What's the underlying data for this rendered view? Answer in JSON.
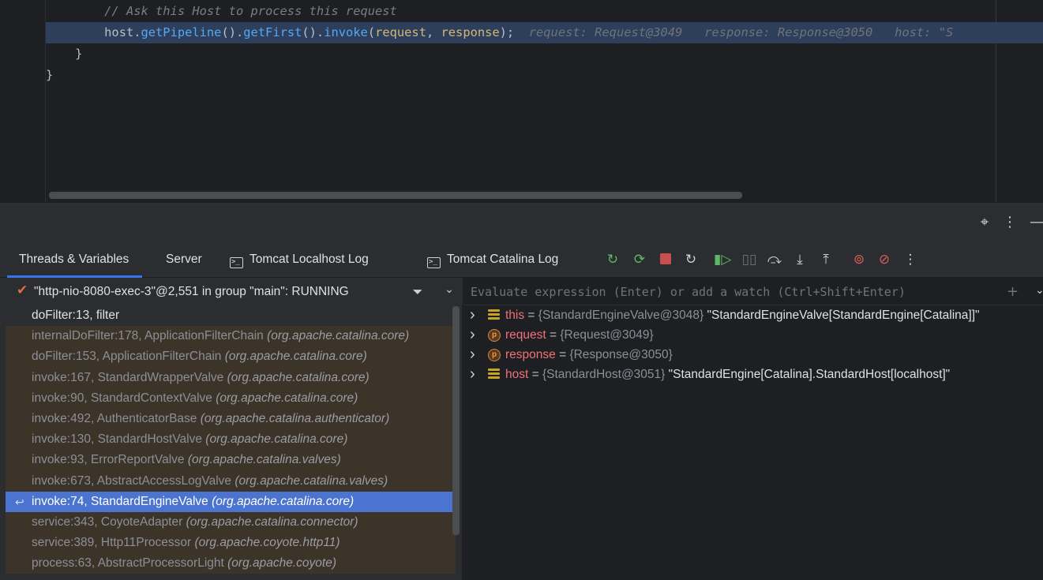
{
  "editor": {
    "lines": [
      {
        "indent": "    ",
        "comment": "// Ask this Host to process this request"
      },
      {
        "indent": "    ",
        "receiver": "host.",
        "m1": "getPipeline",
        "p1": "().",
        "m2": "getFirst",
        "p2": "().",
        "m3": "invoke",
        "p3": "(",
        "a1": "request",
        "p4": ", ",
        "a2": "response",
        "p5": ");",
        "hint1": "request: Request@3049",
        "hint2": "response: Response@3050",
        "hint3": "host: \"S"
      },
      {
        "text": "}"
      },
      {
        "text": "}"
      }
    ]
  },
  "strip": {
    "icons": [
      "target-icon",
      "more-vertical-icon",
      "minimize-icon"
    ]
  },
  "tabs": [
    {
      "label": "Threads & Variables",
      "active": true
    },
    {
      "label": "Server",
      "active": false
    },
    {
      "label": "Tomcat Localhost Log",
      "active": false
    },
    {
      "label": "Tomcat Catalina Log",
      "active": false
    }
  ],
  "toolbar": {
    "rerun": "rerun-icon",
    "rerun_debug": "rerun-debug-icon",
    "stop": "stop-icon",
    "restart": "restart-icon",
    "resume": "resume-icon",
    "pause": "pause-icon",
    "step_over": "step-over-icon",
    "step_into": "step-into-icon",
    "step_out": "step-out-icon",
    "view_breakpoints": "view-breakpoints-icon",
    "mute_breakpoints": "mute-breakpoints-icon",
    "more": "more-vertical-icon",
    "colors": {
      "green": "#5fb865",
      "red": "#db5c5c",
      "stop": "#c94f4f"
    }
  },
  "thread": {
    "label": "\"http-nio-8080-exec-3\"@2,551 in group \"main\": RUNNING"
  },
  "frames": [
    {
      "method": "doFilter:13, filter",
      "pkg": "",
      "kind": "current"
    },
    {
      "method": "internalDoFilter:178, ApplicationFilterChain ",
      "pkg": "(org.apache.catalina.core)",
      "kind": "lib"
    },
    {
      "method": "doFilter:153, ApplicationFilterChain ",
      "pkg": "(org.apache.catalina.core)",
      "kind": "lib"
    },
    {
      "method": "invoke:167, StandardWrapperValve ",
      "pkg": "(org.apache.catalina.core)",
      "kind": "lib"
    },
    {
      "method": "invoke:90, StandardContextValve ",
      "pkg": "(org.apache.catalina.core)",
      "kind": "lib"
    },
    {
      "method": "invoke:492, AuthenticatorBase ",
      "pkg": "(org.apache.catalina.authenticator)",
      "kind": "lib"
    },
    {
      "method": "invoke:130, StandardHostValve ",
      "pkg": "(org.apache.catalina.core)",
      "kind": "lib"
    },
    {
      "method": "invoke:93, ErrorReportValve ",
      "pkg": "(org.apache.catalina.valves)",
      "kind": "lib"
    },
    {
      "method": "invoke:673, AbstractAccessLogValve ",
      "pkg": "(org.apache.catalina.valves)",
      "kind": "lib"
    },
    {
      "method": "invoke:74, StandardEngineValve ",
      "pkg": "(org.apache.catalina.core)",
      "kind": "selected"
    },
    {
      "method": "service:343, CoyoteAdapter ",
      "pkg": "(org.apache.catalina.connector)",
      "kind": "lib"
    },
    {
      "method": "service:389, Http11Processor ",
      "pkg": "(org.apache.coyote.http11)",
      "kind": "lib"
    },
    {
      "method": "process:63, AbstractProcessorLight ",
      "pkg": "(org.apache.coyote)",
      "kind": "lib"
    }
  ],
  "evaluate": {
    "placeholder": "Evaluate expression (Enter) or add a watch (Ctrl+Shift+Enter)"
  },
  "variables": [
    {
      "name": "this",
      "type": "{StandardEngineValve@3048}",
      "value": " \"StandardEngineValve[StandardEngine[Catalina]]\"",
      "icon": "field"
    },
    {
      "name": "request",
      "type": "{Request@3049}",
      "value": "",
      "icon": "param"
    },
    {
      "name": "response",
      "type": "{Response@3050}",
      "value": "",
      "icon": "param"
    },
    {
      "name": "host",
      "type": "{StandardHost@3051}",
      "value": " \"StandardEngine[Catalina].StandardHost[localhost]\"",
      "icon": "field"
    }
  ]
}
